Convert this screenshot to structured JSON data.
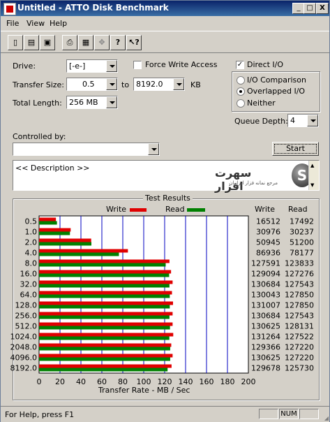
{
  "window": {
    "title": "Untitled - ATTO Disk Benchmark",
    "min_glyph": "_",
    "max_glyph": "□",
    "close_glyph": "X"
  },
  "menu": [
    "File",
    "View",
    "Help"
  ],
  "toolbar": [
    "new-icon",
    "open-icon",
    "save-icon",
    "print-icon",
    "print-preview-icon",
    "move-icon",
    "help-icon",
    "context-help-icon"
  ],
  "form": {
    "drive_label": "Drive:",
    "drive_value": "[-e-]",
    "transfer_size_label": "Transfer Size:",
    "ts_from": "0.5",
    "ts_to_label": "to",
    "ts_to": "8192.0",
    "ts_unit": "KB",
    "total_length_label": "Total Length:",
    "total_length": "256 MB",
    "force_write_label": "Force Write Access",
    "force_write_checked": false,
    "direct_io_label": "Direct I/O",
    "direct_io_checked": true,
    "io_comparison_label": "I/O Comparison",
    "overlapped_label": "Overlapped I/O",
    "neither_label": "Neither",
    "selected_mode": "Overlapped I/O",
    "queue_depth_label": "Queue Depth:",
    "queue_depth": "4",
    "controlled_by_label": "Controlled by:",
    "controlled_by_value": "",
    "start_label": "Start",
    "description": "<< Description >>",
    "logo_text": "سهرت افزار",
    "logo_sub": "مرجع نمانه فزار ایرانیان"
  },
  "results": {
    "group_title": "Test Results",
    "write_legend": "Write",
    "read_legend": "Read",
    "col_write": "Write",
    "col_read": "Read",
    "xlabel": "Transfer Rate - MB / Sec"
  },
  "chart_data": {
    "type": "bar",
    "orientation": "horizontal",
    "title": "Test Results",
    "xlabel": "Transfer Rate - MB / Sec",
    "xlim": [
      0,
      200
    ],
    "xticks": [
      0,
      20,
      40,
      60,
      80,
      100,
      120,
      140,
      160,
      180,
      200
    ],
    "categories": [
      "0.5",
      "1.0",
      "2.0",
      "4.0",
      "8.0",
      "16.0",
      "32.0",
      "64.0",
      "128.0",
      "256.0",
      "512.0",
      "1024.0",
      "2048.0",
      "4096.0",
      "8192.0"
    ],
    "series": [
      {
        "name": "Write",
        "color": "#e00000",
        "values": [
          16.1,
          30.2,
          49.8,
          84.9,
          124.6,
          126.1,
          127.6,
          127.0,
          128.0,
          127.6,
          127.6,
          128.2,
          126.3,
          127.6,
          126.6
        ],
        "raw": [
          "16512",
          "30976",
          "50945",
          "86936",
          "127591",
          "129094",
          "130684",
          "130043",
          "131007",
          "130684",
          "130625",
          "131264",
          "129366",
          "130625",
          "129678"
        ]
      },
      {
        "name": "Read",
        "color": "#008000",
        "values": [
          17.1,
          29.5,
          50.0,
          76.3,
          121.0,
          124.3,
          124.6,
          124.9,
          124.9,
          124.6,
          125.1,
          124.5,
          125.3,
          125.3,
          122.8
        ],
        "raw": [
          "17492",
          "30237",
          "51200",
          "78177",
          "123833",
          "127276",
          "127543",
          "127850",
          "127850",
          "127543",
          "128131",
          "127522",
          "127220",
          "127220",
          "125730"
        ]
      }
    ],
    "grid": true,
    "legend": "top"
  },
  "status": {
    "text": "For Help, press F1",
    "num": "NUM"
  }
}
